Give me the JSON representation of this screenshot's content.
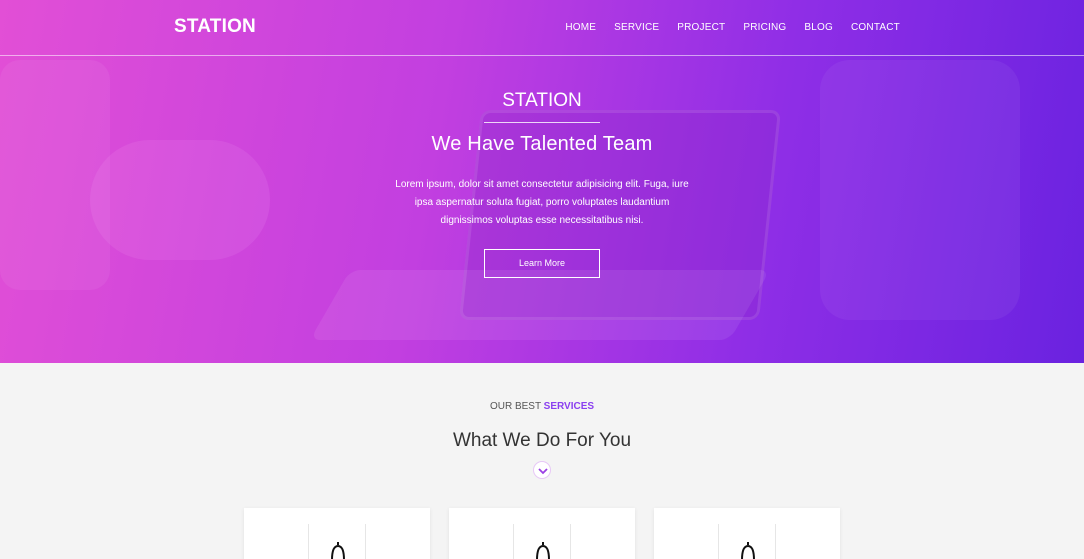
{
  "brand": "STATION",
  "nav": {
    "items": [
      "HOME",
      "SERVICE",
      "PROJECT",
      "PRICING",
      "BLOG",
      "CONTACT"
    ]
  },
  "hero": {
    "brand": "STATION",
    "title": "We Have Talented Team",
    "text": "Lorem ipsum, dolor sit amet consectetur adipisicing elit. Fuga, iure ipsa aspernatur soluta fugiat, porro voluptates laudantium dignissimos voluptas esse necessitatibus nisi.",
    "button": "Learn More"
  },
  "services": {
    "subtitle_prefix": "OUR BEST",
    "subtitle_accent": "SERVICES",
    "title": "What We Do For You",
    "cards": [
      {
        "icon": "bell-icon"
      },
      {
        "icon": "bell-icon"
      },
      {
        "icon": "bell-icon"
      }
    ]
  },
  "colors": {
    "gradient_start": "#e24fd6",
    "gradient_end": "#6a22e0",
    "accent": "#8a3ff0"
  }
}
